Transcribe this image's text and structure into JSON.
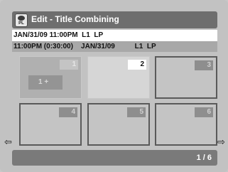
{
  "header": {
    "title": "Edit - Title Combining",
    "icon_label": "PL"
  },
  "info": {
    "line1": "JAN/31/09 11:00PM  L1  LP",
    "line2": "11:00PM (0:30:00)    JAN/31/09          L1  LP"
  },
  "thumbnails": [
    {
      "number": "1",
      "marker": "1 +"
    },
    {
      "number": "2"
    },
    {
      "number": "3"
    },
    {
      "number": "4"
    },
    {
      "number": "5"
    },
    {
      "number": "6"
    }
  ],
  "nav": {
    "left_icon": "left-arrow-icon",
    "right_icon": "right-arrow-icon"
  },
  "footer": {
    "page_indicator": "1 / 6"
  }
}
